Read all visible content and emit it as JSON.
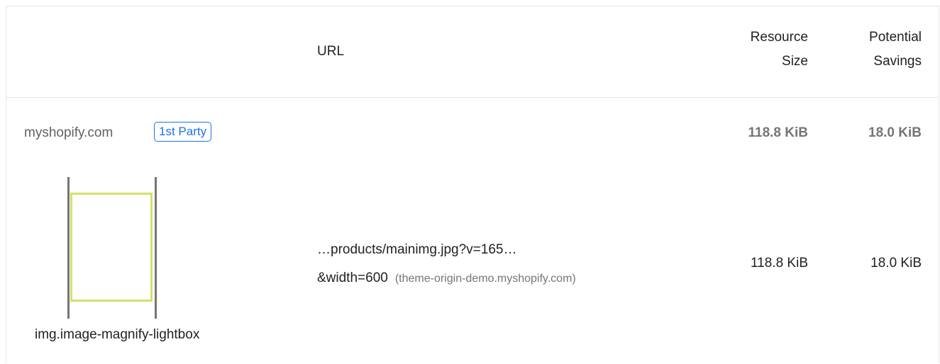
{
  "table": {
    "headers": {
      "url": "URL",
      "resource_size_line1": "Resource",
      "resource_size_line2": "Size",
      "potential_savings_line1": "Potential",
      "potential_savings_line2": "Savings"
    },
    "group": {
      "entity": "myshopify.com",
      "badge": "1st Party",
      "resource_size": "118.8 KiB",
      "potential_savings": "18.0 KiB"
    },
    "items": [
      {
        "node_label": "img.image-magnify-lightbox",
        "url_line1": "…products/mainimg.jpg?v=165…",
        "url_line2": "&width=600",
        "origin": "(theme-origin-demo.myshopify.com)",
        "resource_size": "118.8 KiB",
        "potential_savings": "18.0 KiB"
      }
    ]
  },
  "colors": {
    "badge": "#1a73e8",
    "thumbnail_highlight": "#d4e06b",
    "border": "#e6e6e6",
    "muted_text": "#757575"
  }
}
